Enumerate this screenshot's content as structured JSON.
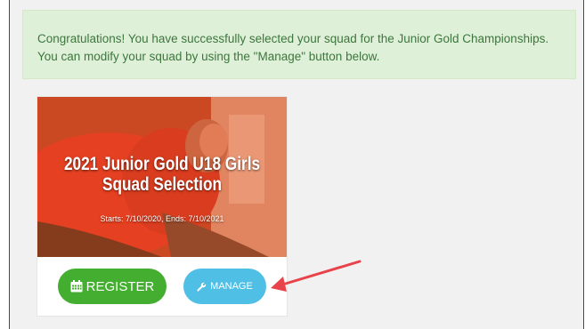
{
  "alert": {
    "message": "Congratulations! You have successfully selected your squad for the Junior Gold Championships. You can modify your squad by using the \"Manage\" button below."
  },
  "card": {
    "title": "2021 Junior Gold U18 Girls Squad Selection",
    "dates": "Starts: 7/10/2020, Ends: 7/10/2021"
  },
  "buttons": {
    "register_label": "REGISTER",
    "manage_label": "MANAGE",
    "register_icon": "calendar-icon",
    "manage_icon": "wrench-icon"
  },
  "colors": {
    "alert_bg": "#dff0d8",
    "alert_text": "#3c763d",
    "register": "#43ae2f",
    "manage": "#4fbfe6",
    "annotation_arrow": "#e8434a"
  }
}
